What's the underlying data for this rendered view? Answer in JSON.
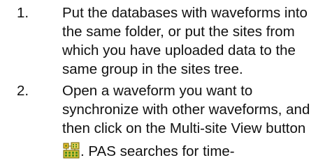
{
  "steps": [
    {
      "number": "1.",
      "lines": [
        "Put the databases with waveforms into",
        "the same folder, or put the sites from",
        "which you have uploaded data to the",
        "same group in the sites tree."
      ]
    },
    {
      "number": "2.",
      "lines": [
        "Open a waveform you want to",
        "synchronize with other waveforms, and",
        "then click on the Multi-site View button",
        ". PAS searches for time-"
      ],
      "icon": "multi-site-view-icon"
    }
  ]
}
